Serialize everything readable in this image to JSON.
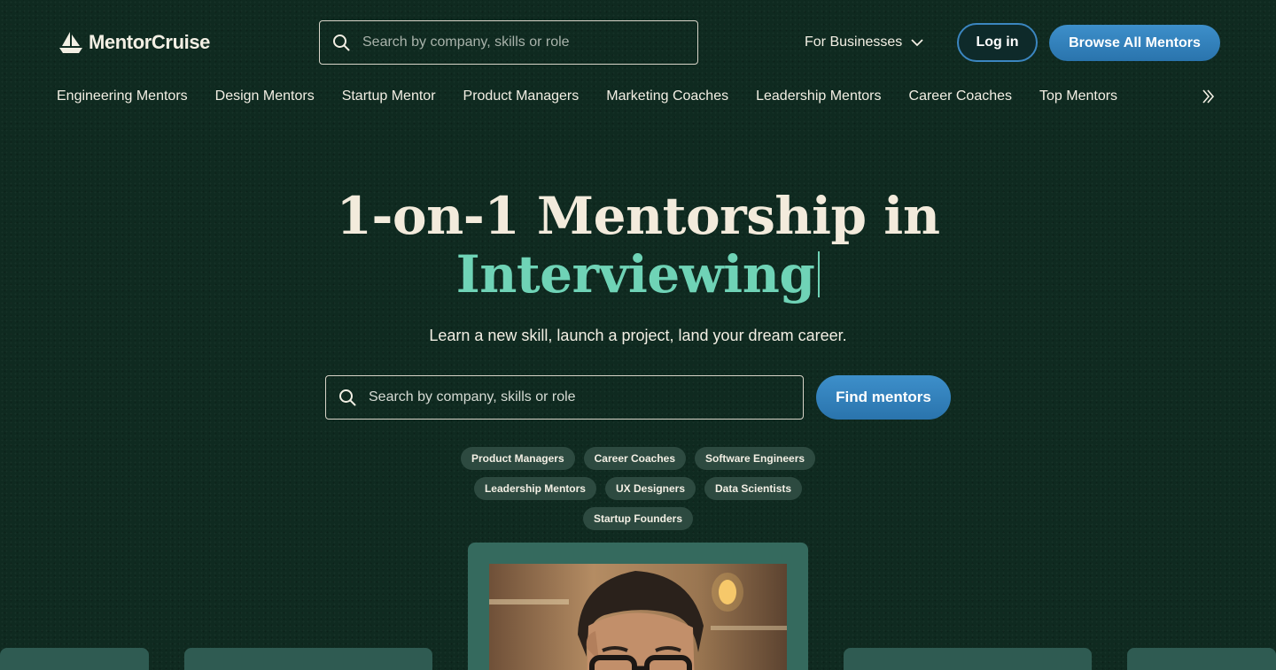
{
  "brand": {
    "name": "MentorCruise",
    "logo_icon": "sailboat-icon"
  },
  "header": {
    "search_placeholder": "Search by company, skills or role",
    "for_businesses": "For Businesses",
    "login": "Log in",
    "browse": "Browse All Mentors"
  },
  "nav": {
    "items": [
      "Engineering Mentors",
      "Design Mentors",
      "Startup Mentor",
      "Product Managers",
      "Marketing Coaches",
      "Leadership Mentors",
      "Career Coaches",
      "Top Mentors"
    ],
    "more_icon": "double-chevron-right-icon"
  },
  "hero": {
    "title_line1": "1-on-1 Mentorship in",
    "title_line2": "Interviewing",
    "subtitle": "Learn a new skill, launch a project, land your dream career.",
    "search_placeholder": "Search by company, skills or role",
    "find_button": "Find mentors",
    "chips": [
      "Product Managers",
      "Career Coaches",
      "Software Engineers",
      "Leadership Mentors",
      "UX Designers",
      "Data Scientists",
      "Startup Founders"
    ]
  },
  "colors": {
    "background": "#0f2a20",
    "accent_text": "#6fd3b6",
    "primary_button": "#2f7fbb",
    "chip_bg": "#2d4a40",
    "card_bg": "#2f5b52"
  }
}
